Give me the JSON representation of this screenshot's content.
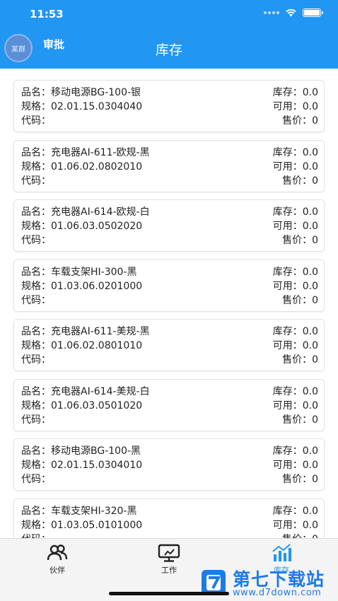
{
  "status_bar": {
    "time": "11:53"
  },
  "header": {
    "avatar_text": "某群",
    "approve_label": "审批",
    "title": "库存"
  },
  "labels": {
    "name": "品名：",
    "spec": "规格：",
    "code": "代码：",
    "stock": "库存：",
    "available": "可用：",
    "price": "售价："
  },
  "items": [
    {
      "name": "移动电源BG-100-银",
      "spec": "02.01.15.0304040",
      "code": "",
      "stock": "0.0",
      "available": "0.0",
      "price": "0"
    },
    {
      "name": "充电器AI-611-欧规-黑",
      "spec": "01.06.02.0802010",
      "code": "",
      "stock": "0.0",
      "available": "0.0",
      "price": "0"
    },
    {
      "name": "充电器AI-614-欧规-白",
      "spec": "01.06.03.0502020",
      "code": "",
      "stock": "0.0",
      "available": "0.0",
      "price": "0"
    },
    {
      "name": "车载支架HI-300-黑",
      "spec": "01.03.06.0201000",
      "code": "",
      "stock": "0.0",
      "available": "0.0",
      "price": "0"
    },
    {
      "name": "充电器AI-611-美规-黑",
      "spec": "01.06.02.0801010",
      "code": "",
      "stock": "0.0",
      "available": "0.0",
      "price": "0"
    },
    {
      "name": "充电器AI-614-美规-白",
      "spec": "01.06.03.0501020",
      "code": "",
      "stock": "0.0",
      "available": "0.0",
      "price": "0"
    },
    {
      "name": "移动电源BG-100-黑",
      "spec": "02.01.15.0304010",
      "code": "",
      "stock": "0.0",
      "available": "0.0",
      "price": "0"
    },
    {
      "name": "车载支架HI-320-黑",
      "spec": "01.03.05.0101000",
      "code": "",
      "stock": "0.0",
      "available": "0.0",
      "price": "0"
    }
  ],
  "tabbar": {
    "tabs": [
      {
        "label": "伙伴",
        "icon": "partners-icon"
      },
      {
        "label": "工作",
        "icon": "monitor-icon"
      },
      {
        "label": "库存",
        "icon": "chart-icon",
        "active": true
      }
    ]
  },
  "watermark": {
    "title": "第七下载站",
    "url": "www.d7down.com"
  },
  "colors": {
    "primary": "#2196f3",
    "watermark": "#1e7be6"
  }
}
